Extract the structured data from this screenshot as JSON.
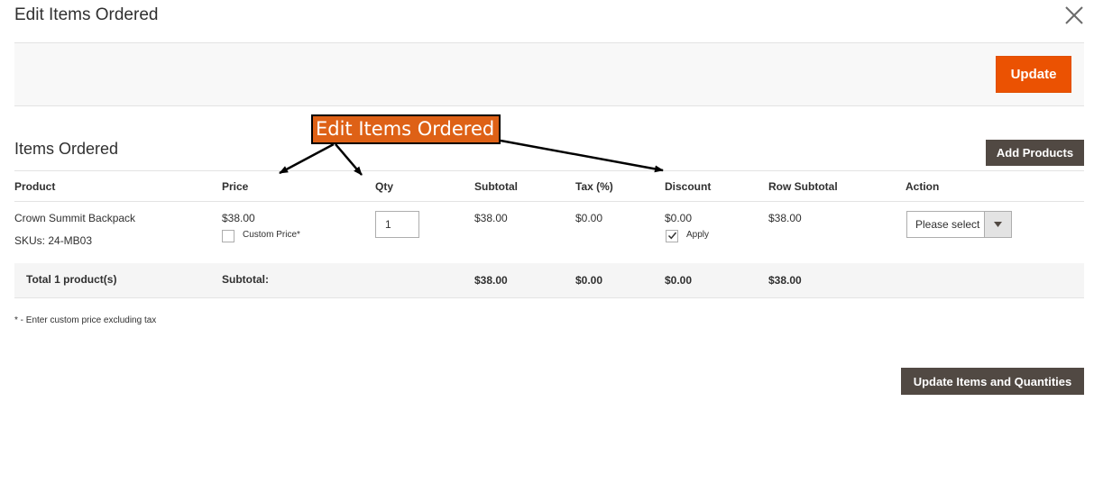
{
  "modal": {
    "title": "Edit Items Ordered"
  },
  "action_bar": {
    "update_label": "Update"
  },
  "section": {
    "title": "Items Ordered",
    "add_products_label": "Add Products"
  },
  "table": {
    "headers": [
      "Product",
      "Price",
      "Qty",
      "Subtotal",
      "Tax (%)",
      "Discount",
      "Row Subtotal",
      "Action"
    ],
    "row": {
      "product_name": "Crown Summit Backpack",
      "sku": "SKUs: 24-MB03",
      "price": "$38.00",
      "custom_price_label": "Custom Price*",
      "custom_price_checked": false,
      "qty": "1",
      "subtotal": "$38.00",
      "tax": "$0.00",
      "discount": "$0.00",
      "apply_label": "Apply",
      "apply_checked": true,
      "row_subtotal": "$38.00",
      "action_select": "Please select"
    },
    "footer": {
      "total_label": "Total 1 product(s)",
      "subtotal_label": "Subtotal:",
      "subtotal": "$38.00",
      "tax": "$0.00",
      "discount": "$0.00",
      "row_subtotal": "$38.00"
    }
  },
  "note": "* - Enter custom price excluding tax",
  "update_items_label": "Update Items and Quantities",
  "annotation": {
    "label": "Edit Items Ordered"
  },
  "colors": {
    "accent": "#eb5202",
    "secondary_button": "#514943",
    "annotation_bg": "#de6116"
  },
  "icons": {
    "close": "close-icon",
    "dropdown": "chevron-down-icon",
    "check": "check-icon"
  }
}
